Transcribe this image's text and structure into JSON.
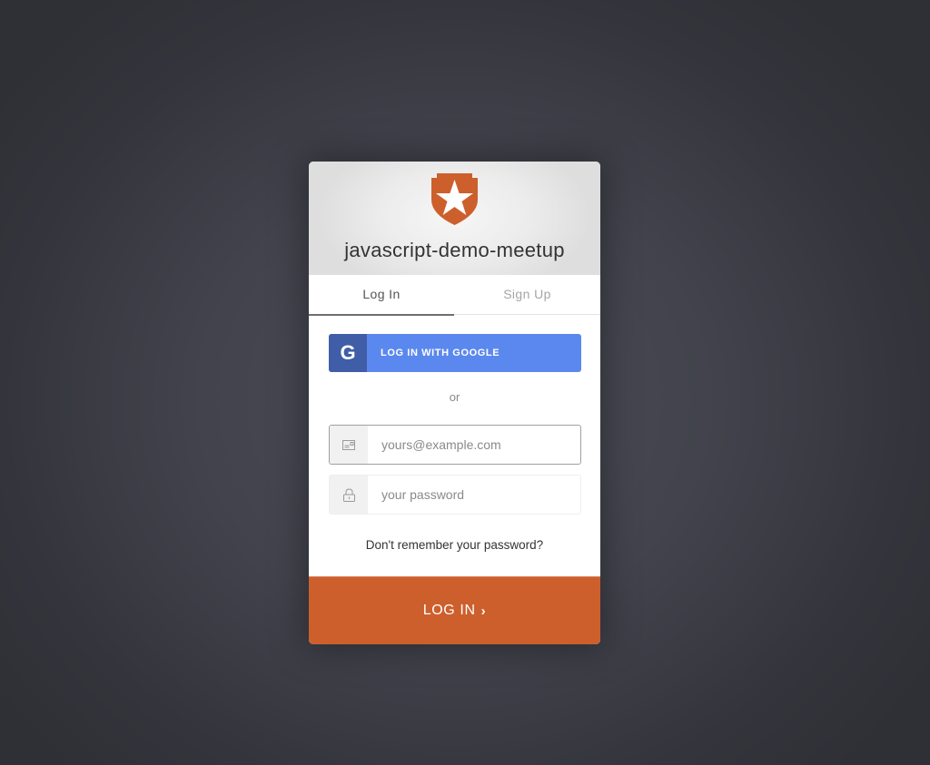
{
  "header": {
    "title": "javascript-demo-meetup",
    "logo_icon": "shield-star-icon",
    "brand_color": "#cd5f2c"
  },
  "tabs": [
    {
      "label": "Log In",
      "active": true
    },
    {
      "label": "Sign Up",
      "active": false
    }
  ],
  "social": {
    "google_label": "LOG IN WITH GOOGLE",
    "google_icon": "google-g-icon",
    "google_glyph": "G",
    "google_color": "#5b88ee",
    "google_icon_bg": "#3f5ea7"
  },
  "divider_text": "or",
  "form": {
    "email": {
      "value": "",
      "placeholder": "yours@example.com",
      "icon": "envelope-icon"
    },
    "password": {
      "value": "",
      "placeholder": "your password",
      "icon": "lock-icon"
    },
    "forgot_label": "Don't remember your password?",
    "submit_label": "LOG IN",
    "submit_chevron": "›"
  }
}
